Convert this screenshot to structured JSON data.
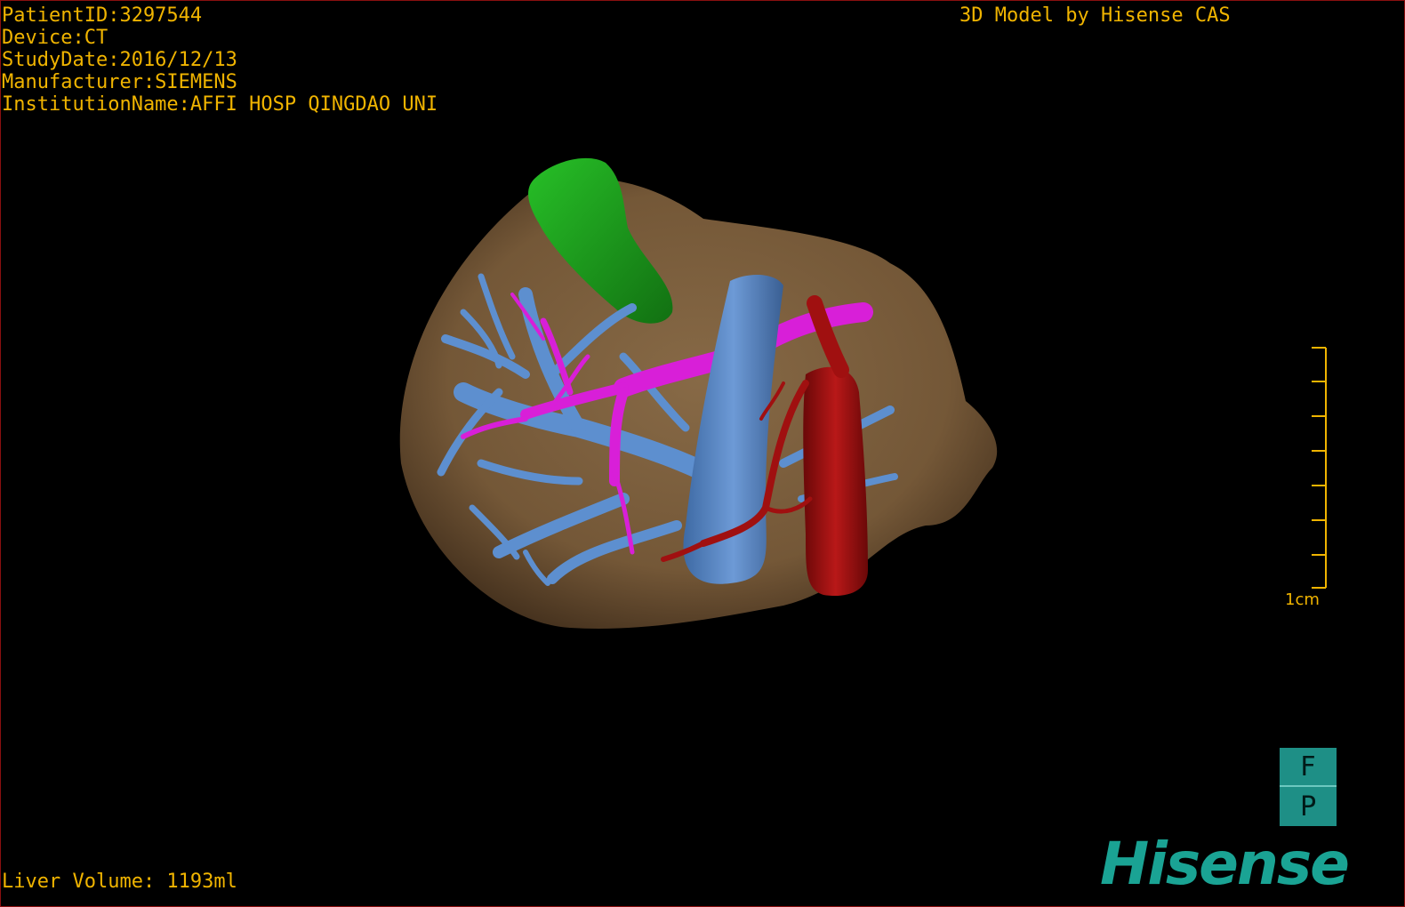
{
  "header": {
    "patient_id": "PatientID:3297544",
    "device": "Device:CT",
    "study_date": "StudyDate:2016/12/13",
    "manufacturer": "Manufacturer:SIEMENS",
    "institution": "InstitutionName:AFFI HOSP QINGDAO UNI",
    "title": "3D Model by Hisense CAS"
  },
  "footer": {
    "liver_volume": "Liver Volume: 1193ml"
  },
  "scale_bar": {
    "label": "1cm"
  },
  "orientation": {
    "top": "F",
    "bottom": "P"
  },
  "brand": "Hisense",
  "colors": {
    "overlay_text": "#f0b400",
    "liver": "#8a6a44",
    "gallbladder": "#1fa31f",
    "hepatic_veins": "#5d8fcf",
    "portal_vein": "#d81fd8",
    "artery": "#a01010",
    "brand": "#1aa394",
    "border": "#8a1010"
  },
  "icons": {
    "scale_bar": "scale-bar-icon",
    "orientation_marker": "orientation-cube-icon"
  }
}
